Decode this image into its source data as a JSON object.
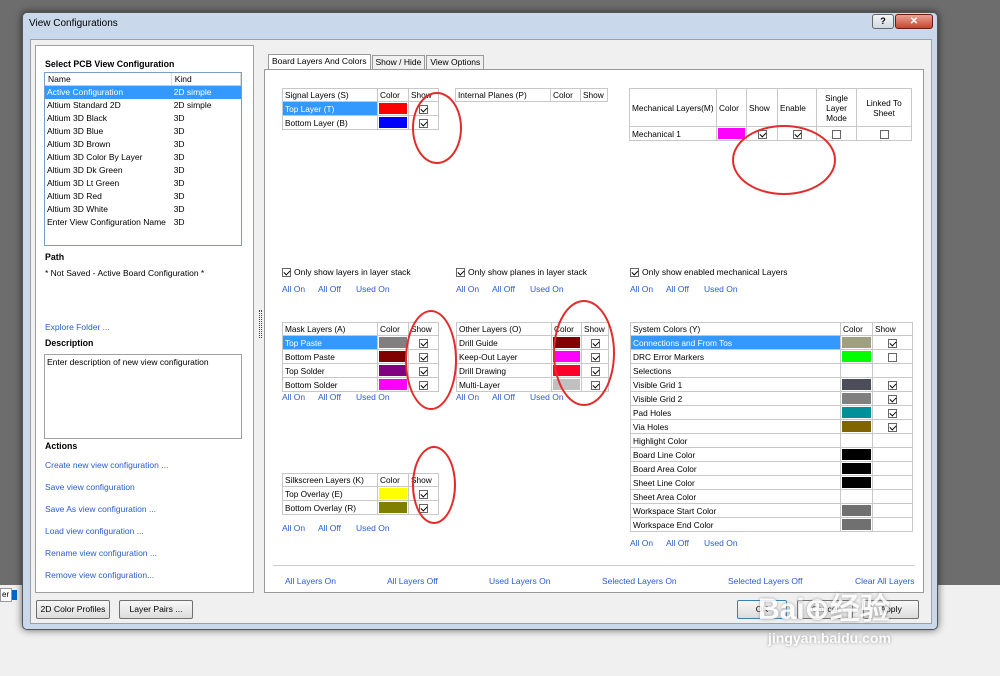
{
  "window": {
    "title": "View Configurations",
    "help": "?",
    "close": "✕"
  },
  "left": {
    "heading": "Select PCB View Configuration",
    "columns": [
      "Name",
      "Kind"
    ],
    "rows": [
      {
        "name": "Active Configuration",
        "kind": "2D simple"
      },
      {
        "name": "Altium Standard 2D",
        "kind": "2D simple"
      },
      {
        "name": "Altium 3D Black",
        "kind": "3D"
      },
      {
        "name": "Altium 3D Blue",
        "kind": "3D"
      },
      {
        "name": "Altium 3D Brown",
        "kind": "3D"
      },
      {
        "name": "Altium 3D Color By Layer",
        "kind": "3D"
      },
      {
        "name": "Altium 3D Dk Green",
        "kind": "3D"
      },
      {
        "name": "Altium 3D Lt Green",
        "kind": "3D"
      },
      {
        "name": "Altium 3D Red",
        "kind": "3D"
      },
      {
        "name": "Altium 3D White",
        "kind": "3D"
      },
      {
        "name": "Enter View Configuration Name",
        "kind": "3D"
      }
    ],
    "path_heading": "Path",
    "path_text": "* Not Saved - Active Board Configuration *",
    "explore_folder": "Explore Folder ...",
    "description_heading": "Description",
    "description_text": "Enter description of new view configuration",
    "actions_heading": "Actions",
    "actions": [
      "Create new view configuration ...",
      "Save view configuration",
      "Save As view configuration ...",
      "Load view configuration ...",
      "Rename view configuration ...",
      "Remove view configuration..."
    ]
  },
  "tabs": [
    "Board Layers And Colors",
    "Show / Hide",
    "View Options"
  ],
  "signal": {
    "header": "Signal Layers (S)",
    "color": "Color",
    "show": "Show",
    "rows": [
      {
        "name": "Top Layer (T)",
        "color": "#ff0000",
        "show": true
      },
      {
        "name": "Bottom Layer (B)",
        "color": "#0000ff",
        "show": true
      }
    ],
    "option": "Only show layers in layer stack"
  },
  "planes": {
    "header": "Internal Planes (P)",
    "color": "Color",
    "show": "Show",
    "option": "Only show planes in layer stack"
  },
  "mech": {
    "header": "Mechanical Layers(M)",
    "color": "Color",
    "show": "Show",
    "enable": "Enable",
    "single": "Single Layer Mode",
    "linked": "Linked To Sheet",
    "rows": [
      {
        "name": "Mechanical 1",
        "color": "#ff00ff",
        "show": true,
        "enable": true,
        "single": false,
        "linked": false
      }
    ],
    "option": "Only show enabled mechanical Layers"
  },
  "mask": {
    "header": "Mask Layers (A)",
    "color": "Color",
    "show": "Show",
    "rows": [
      {
        "name": "Top Paste",
        "color": "#808080",
        "show": true
      },
      {
        "name": "Bottom Paste",
        "color": "#800000",
        "show": true
      },
      {
        "name": "Top Solder",
        "color": "#800080",
        "show": true
      },
      {
        "name": "Bottom Solder",
        "color": "#ff00ff",
        "show": true
      }
    ]
  },
  "other": {
    "header": "Other Layers (O)",
    "color": "Color",
    "show": "Show",
    "rows": [
      {
        "name": "Drill Guide",
        "color": "#800000",
        "show": true
      },
      {
        "name": "Keep-Out Layer",
        "color": "#ff00ff",
        "show": true
      },
      {
        "name": "Drill Drawing",
        "color": "#ff002a",
        "show": true
      },
      {
        "name": "Multi-Layer",
        "color": "#c0c0c0",
        "show": true
      }
    ]
  },
  "system": {
    "header": "System Colors (Y)",
    "color": "Color",
    "show": "Show",
    "rows": [
      {
        "name": "Connections and From Tos",
        "color": "#a0a080",
        "show": true
      },
      {
        "name": "DRC Error Markers",
        "color": "#00ff00",
        "show": false
      },
      {
        "name": "Selections",
        "color": "#ffffff",
        "show": null
      },
      {
        "name": "Visible Grid 1",
        "color": "#4c4c5a",
        "show": true
      },
      {
        "name": "Visible Grid 2",
        "color": "#808080",
        "show": true
      },
      {
        "name": "Pad Holes",
        "color": "#00909a",
        "show": true
      },
      {
        "name": "Via Holes",
        "color": "#806400",
        "show": true
      },
      {
        "name": "Highlight Color",
        "color": "#ffffff",
        "show": null
      },
      {
        "name": "Board Line Color",
        "color": "#000000",
        "show": null
      },
      {
        "name": "Board Area Color",
        "color": "#000000",
        "show": null
      },
      {
        "name": "Sheet Line Color",
        "color": "#000000",
        "show": null
      },
      {
        "name": "Sheet Area Color",
        "color": "#ffffff",
        "show": null
      },
      {
        "name": "Workspace Start Color",
        "color": "#707070",
        "show": null
      },
      {
        "name": "Workspace End Color",
        "color": "#707070",
        "show": null
      }
    ]
  },
  "silk": {
    "header": "Silkscreen Layers (K)",
    "color": "Color",
    "show": "Show",
    "rows": [
      {
        "name": "Top Overlay (E)",
        "color": "#ffff00",
        "show": true
      },
      {
        "name": "Bottom Overlay (R)",
        "color": "#808000",
        "show": true
      }
    ]
  },
  "toggles": {
    "all_on": "All On",
    "all_off": "All Off",
    "used_on": "Used On"
  },
  "bottom_links": [
    "All Layers On",
    "All Layers Off",
    "Used Layers On",
    "Selected Layers On",
    "Selected Layers Off",
    "Clear All Layers"
  ],
  "footer": {
    "color_profiles": "2D Color Profiles",
    "layer_pairs": "Layer Pairs ...",
    "ok": "OK",
    "cancel": "Cancel",
    "apply": "Apply"
  },
  "watermark": {
    "brand": "Bai⊕经验",
    "url": "jingyan.baidu.com"
  },
  "bg_tab": "er"
}
